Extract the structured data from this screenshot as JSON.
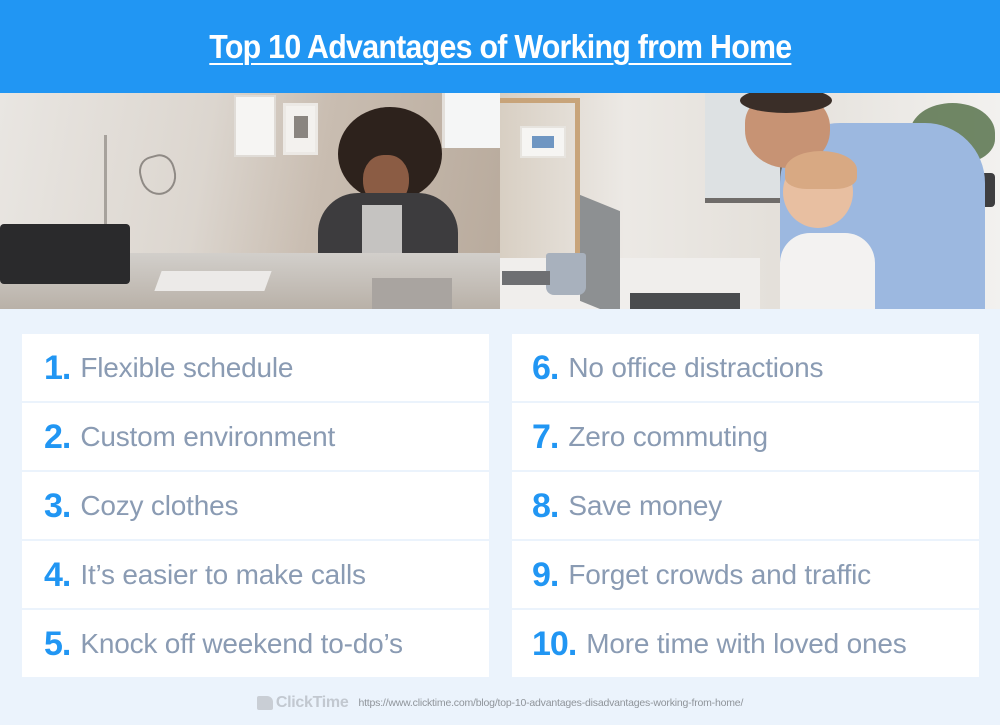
{
  "header": {
    "title": "Top 10 Advantages of Working from Home"
  },
  "colors": {
    "header_bg": "#2196F3",
    "number": "#2196F3",
    "item_text": "#8A9BB3",
    "page_bg": "#EBF3FC",
    "item_bg": "#FFFFFF"
  },
  "photos": {
    "left": "woman working at a home office desk with lamp and printer",
    "right": "man working on laptop holding toddler daughter"
  },
  "advantages": {
    "left": [
      {
        "num": "1.",
        "text": "Flexible schedule"
      },
      {
        "num": "2.",
        "text": "Custom environment"
      },
      {
        "num": "3.",
        "text": "Cozy clothes"
      },
      {
        "num": "4.",
        "text": "It’s easier to make calls"
      },
      {
        "num": "5.",
        "text": "Knock off weekend to-do’s"
      }
    ],
    "right": [
      {
        "num": "6.",
        "text": "No office distractions"
      },
      {
        "num": "7.",
        "text": "Zero commuting"
      },
      {
        "num": "8.",
        "text": "Save money"
      },
      {
        "num": "9.",
        "text": "Forget crowds and traffic"
      },
      {
        "num": "10.",
        "text": "More time with loved ones"
      }
    ]
  },
  "footer": {
    "logo_text": "ClickTime",
    "logo_icon": "clicktime-logo-icon",
    "url": "https://www.clicktime.com/blog/top-10-advantages-disadvantages-working-from-home/"
  }
}
